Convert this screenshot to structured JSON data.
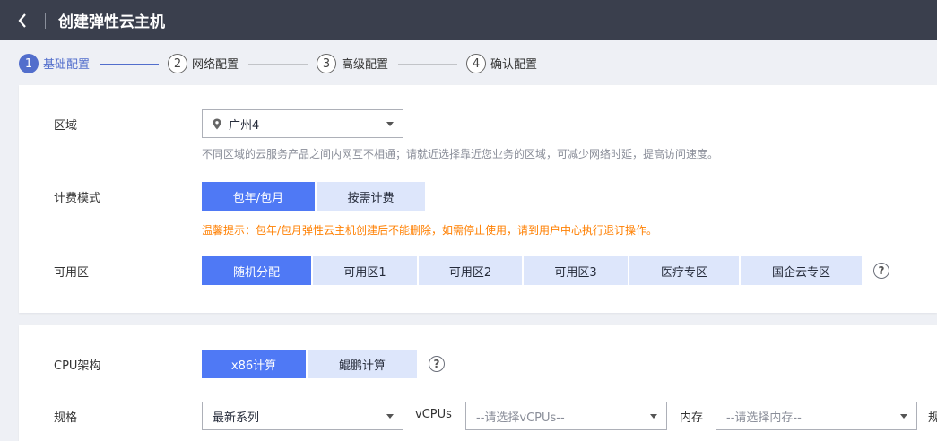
{
  "header": {
    "title": "创建弹性云主机"
  },
  "steps": [
    {
      "num": "1",
      "label": "基础配置"
    },
    {
      "num": "2",
      "label": "网络配置"
    },
    {
      "num": "3",
      "label": "高级配置"
    },
    {
      "num": "4",
      "label": "确认配置"
    }
  ],
  "region": {
    "label": "区域",
    "value": "广州4",
    "hint": "不同区域的云服务产品之间内网互不相通；请就近选择靠近您业务的区域，可减少网络时延，提高访问速度。"
  },
  "billing": {
    "label": "计费模式",
    "options": [
      "包年/包月",
      "按需计费"
    ],
    "warning": "温馨提示：包年/包月弹性云主机创建后不能删除，如需停止使用，请到用户中心执行退订操作。"
  },
  "zone": {
    "label": "可用区",
    "options": [
      "随机分配",
      "可用区1",
      "可用区2",
      "可用区3",
      "医疗专区",
      "国企云专区"
    ],
    "help": "?"
  },
  "cpu": {
    "label": "CPU架构",
    "options": [
      "x86计算",
      "鲲鹏计算"
    ],
    "help": "?"
  },
  "spec": {
    "label": "规格",
    "series_value": "最新系列",
    "vcpus_label": "vCPUs",
    "vcpus_placeholder": "--请选择vCPUs--",
    "memory_label": "内存",
    "memory_placeholder": "--请选择内存--",
    "cut_label": "规"
  },
  "colors": {
    "header_bg": "#3a3f4d",
    "accent": "#526ecc",
    "button_active": "#4f79f5",
    "button_idle": "#dde6fb",
    "warning": "#ff7f00"
  }
}
